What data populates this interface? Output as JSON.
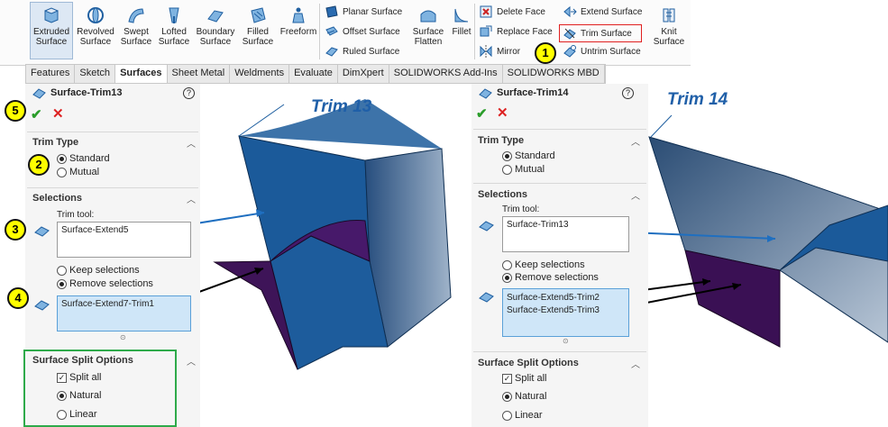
{
  "ribbon": {
    "buttons": [
      {
        "id": "extruded",
        "label1": "Extruded",
        "label2": "Surface"
      },
      {
        "id": "revolved",
        "label1": "Revolved",
        "label2": "Surface"
      },
      {
        "id": "swept",
        "label1": "Swept",
        "label2": "Surface"
      },
      {
        "id": "lofted",
        "label1": "Lofted",
        "label2": "Surface"
      },
      {
        "id": "boundary",
        "label1": "Boundary",
        "label2": "Surface"
      },
      {
        "id": "filled",
        "label1": "Filled",
        "label2": "Surface"
      },
      {
        "id": "freeform",
        "label1": "Freeform",
        "label2": ""
      },
      {
        "id": "flatten",
        "label1": "Surface",
        "label2": "Flatten"
      },
      {
        "id": "fillet",
        "label1": "Fillet",
        "label2": ""
      },
      {
        "id": "knit",
        "label1": "Knit",
        "label2": "Surface"
      }
    ],
    "small": {
      "planar": "Planar Surface",
      "offset": "Offset Surface",
      "ruled": "Ruled Surface",
      "delete": "Delete Face",
      "replace": "Replace Face",
      "mirror": "Mirror",
      "extend": "Extend Surface",
      "trim": "Trim Surface",
      "untrim": "Untrim Surface"
    },
    "highlight_color": "#e02020"
  },
  "tabs": [
    "Features",
    "Sketch",
    "Surfaces",
    "Sheet Metal",
    "Weldments",
    "Evaluate",
    "DimXpert",
    "SOLIDWORKS Add-Ins",
    "SOLIDWORKS MBD"
  ],
  "active_tab": "Surfaces",
  "left_panel": {
    "title": "Surface-Trim13",
    "trim_type": "Trim Type",
    "standard": "Standard",
    "mutual": "Mutual",
    "selections": "Selections",
    "trim_tool_label": "Trim tool:",
    "trim_tool_value": "Surface-Extend5",
    "keep": "Keep selections",
    "remove": "Remove selections",
    "removed_item": "Surface-Extend7-Trim1",
    "split_options": "Surface Split Options",
    "split_all": "Split all",
    "natural": "Natural",
    "linear": "Linear",
    "group_border_color": "#2eaa4a"
  },
  "right_panel": {
    "title": "Surface-Trim14",
    "trim_type": "Trim Type",
    "standard": "Standard",
    "mutual": "Mutual",
    "selections": "Selections",
    "trim_tool_label": "Trim tool:",
    "trim_tool_value": "Surface-Trim13",
    "keep": "Keep selections",
    "remove": "Remove selections",
    "removed_item1": "Surface-Extend5-Trim2",
    "removed_item2": "Surface-Extend5-Trim3",
    "split_options": "Surface Split Options",
    "split_all": "Split all",
    "natural": "Natural",
    "linear": "Linear"
  },
  "callouts": [
    "1",
    "2",
    "3",
    "4",
    "5"
  ],
  "headings": {
    "left": "Trim 13",
    "right": "Trim 14"
  },
  "icons": [
    "extruded-surface-icon",
    "revolved-surface-icon",
    "swept-surface-icon",
    "lofted-surface-icon",
    "boundary-surface-icon",
    "filled-surface-icon",
    "freeform-icon",
    "planar-surface-icon",
    "offset-surface-icon",
    "ruled-surface-icon",
    "surface-flatten-icon",
    "fillet-icon",
    "delete-face-icon",
    "replace-face-icon",
    "mirror-icon",
    "extend-surface-icon",
    "trim-surface-icon",
    "untrim-surface-icon",
    "knit-surface-icon",
    "confirm-check-icon",
    "cancel-x-icon",
    "help-icon",
    "trim-tool-selector-icon",
    "pieces-selector-icon"
  ],
  "colors": {
    "surface_blue": "#1f5fa0",
    "surface_dark": "#16406e",
    "purple": "#4a1060",
    "heading_blue": "#1f5fa8",
    "callout_yellow": "#ffff00"
  }
}
